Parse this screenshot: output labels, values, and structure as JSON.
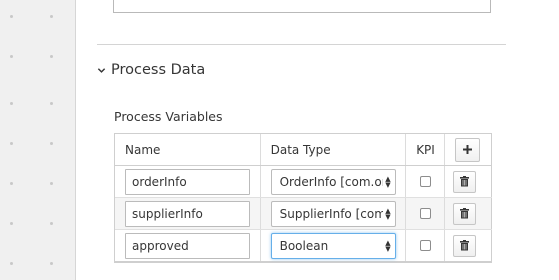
{
  "section": {
    "title": "Process Data",
    "chevron_icon": "chevron-down-icon"
  },
  "variables": {
    "label": "Process Variables",
    "columns": {
      "name": "Name",
      "type": "Data Type",
      "kpi": "KPI"
    },
    "add_icon": "plus-icon",
    "delete_icon": "trash-icon",
    "rows": [
      {
        "name": "orderInfo",
        "type": "OrderInfo [com.or",
        "kpi": false
      },
      {
        "name": "supplierInfo",
        "type": "SupplierInfo [com.",
        "kpi": false
      },
      {
        "name": "approved",
        "type": "Boolean",
        "kpi": false
      }
    ]
  },
  "colors": {
    "focus_border": "#66afe9",
    "alt_row": "#f5f5f5",
    "rail": "#f0f0f0"
  }
}
